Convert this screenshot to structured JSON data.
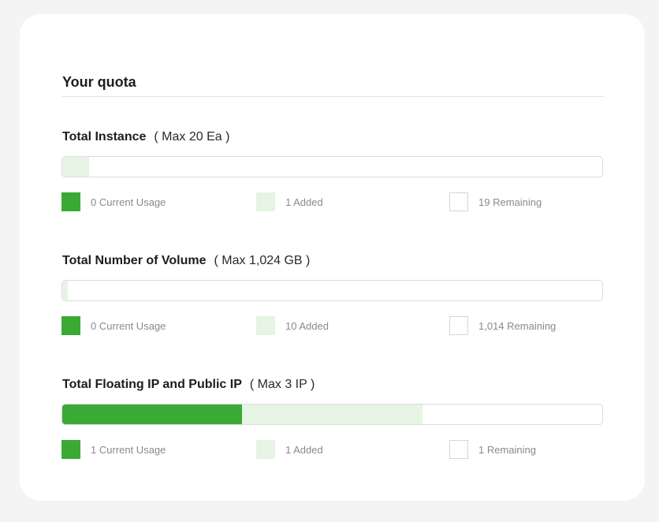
{
  "title": "Your quota",
  "colors": {
    "usage": "#3aaa35",
    "added": "#e6f5e3",
    "remaining": "#ffffff"
  },
  "sections": [
    {
      "title": "Total Instance",
      "max": "( Max 20 Ea )",
      "max_value": 20,
      "usage_value": 0,
      "added_value": 1,
      "remaining_value": 19,
      "usage_text": "0 Current Usage",
      "added_text": "1 Added",
      "remaining_text": "19 Remaining"
    },
    {
      "title": "Total Number of Volume",
      "max": "( Max 1,024 GB )",
      "max_value": 1024,
      "usage_value": 0,
      "added_value": 10,
      "remaining_value": 1014,
      "usage_text": "0 Current Usage",
      "added_text": "10 Added",
      "remaining_text": "1,014 Remaining"
    },
    {
      "title": "Total Floating IP and Public IP",
      "max": "( Max 3 IP )",
      "max_value": 3,
      "usage_value": 1,
      "added_value": 1,
      "remaining_value": 1,
      "usage_text": "1 Current Usage",
      "added_text": "1 Added",
      "remaining_text": "1 Remaining"
    }
  ]
}
